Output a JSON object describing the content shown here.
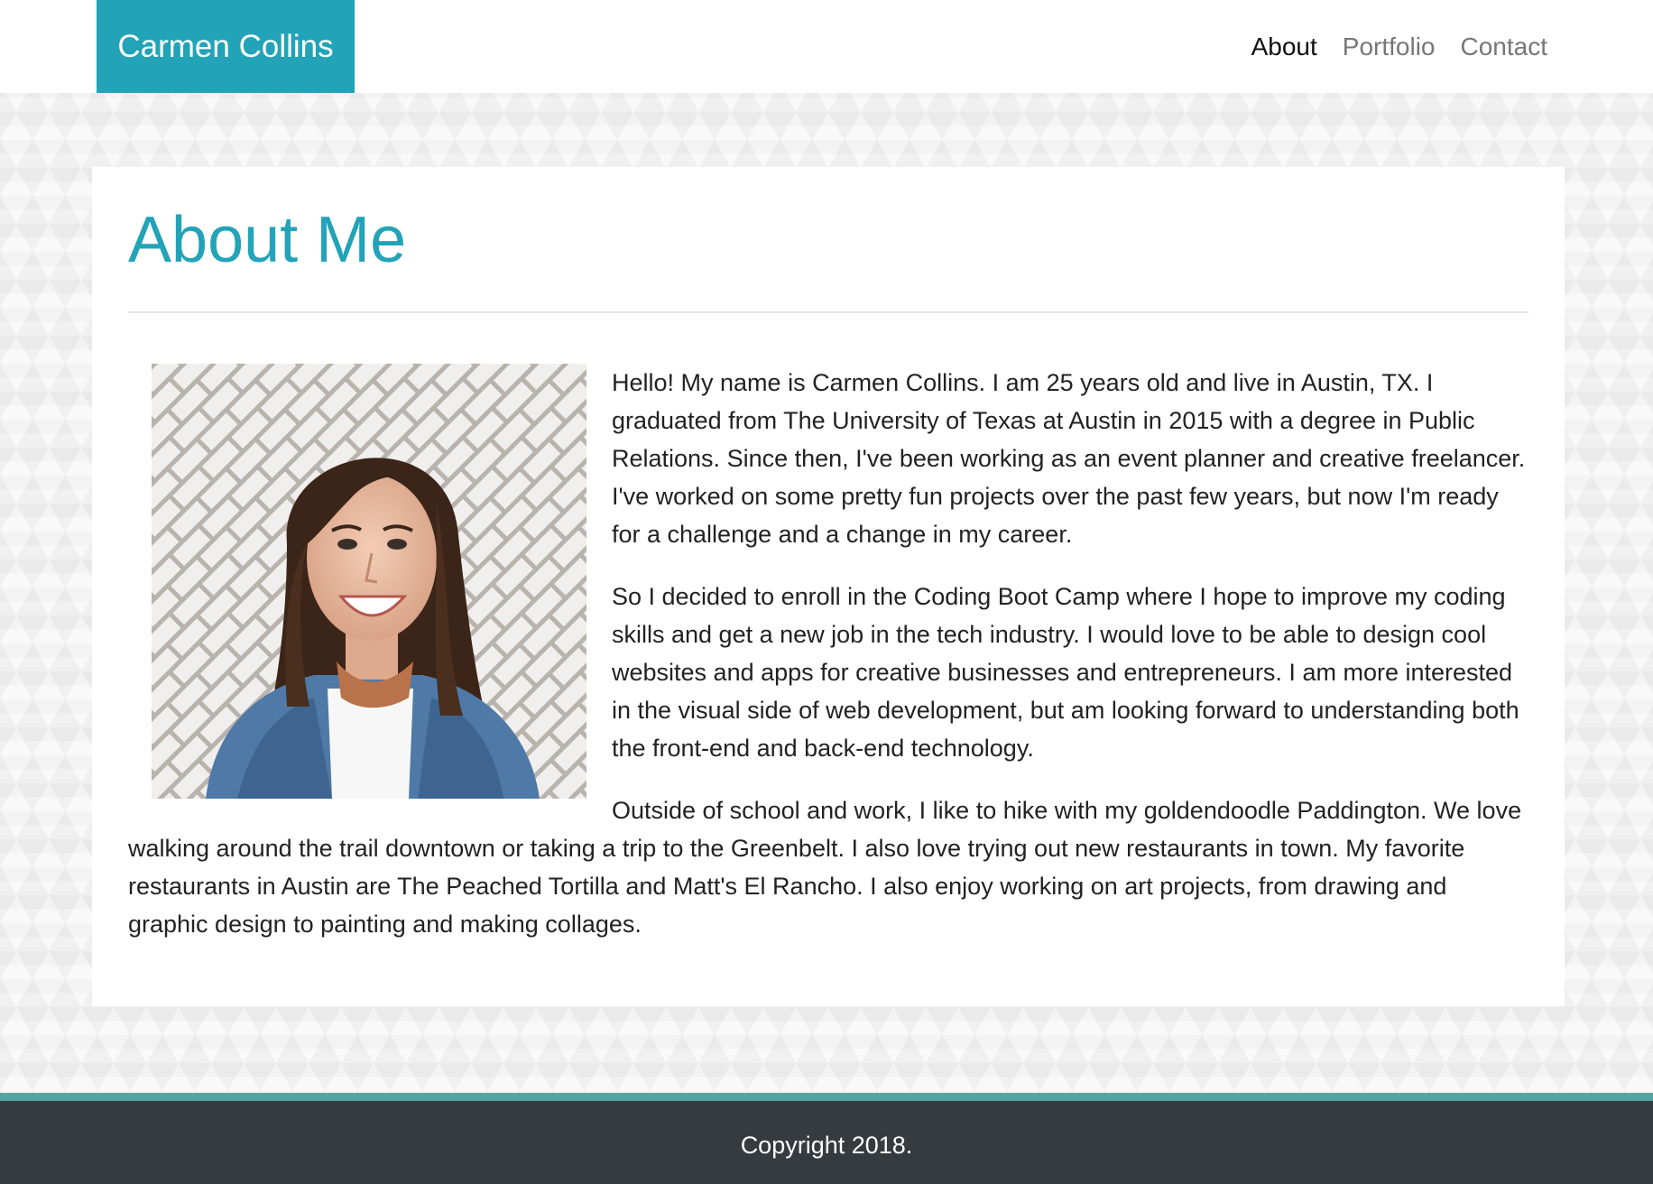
{
  "navbar": {
    "brand": "Carmen Collins",
    "links": [
      {
        "label": "About",
        "active": true
      },
      {
        "label": "Portfolio",
        "active": false
      },
      {
        "label": "Contact",
        "active": false
      }
    ]
  },
  "main": {
    "title": "About Me",
    "paragraphs": [
      "Hello! My name is Carmen Collins. I am 25 years old and live in Austin, TX. I graduated from The University of Texas at Austin in 2015 with a degree in Public Relations. Since then, I've been working as an event planner and creative freelancer. I've worked on some pretty fun projects over the past few years, but now I'm ready for a challenge and a change in my career.",
      "So I decided to enroll in the Coding Boot Camp where I hope to improve my coding skills and get a new job in the tech industry. I would love to be able to design cool websites and apps for creative businesses and entrepreneurs. I am more interested in the visual side of web development, but am looking forward to understanding both the front-end and back-end technology.",
      "Outside of school and work, I like to hike with my goldendoodle Paddington. We love walking around the trail downtown or taking a trip to the Greenbelt. I also love trying out new restaurants in town. My favorite restaurants in Austin are The Peached Tortilla and Matt's El Rancho. I also enjoy working on art projects, from drawing and graphic design to painting and making collages."
    ]
  },
  "footer": {
    "copyright": "Copyright 2018."
  },
  "colors": {
    "accent": "#22a3b8",
    "footer_bg": "#363b40",
    "footer_border": "#55a6a3"
  }
}
